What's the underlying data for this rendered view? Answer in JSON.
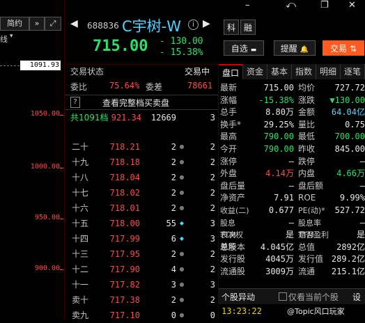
{
  "top_controls": {
    "minimize": "–",
    "back": "⤺",
    "restore": "❐",
    "close": "✕"
  },
  "left_strip": {
    "tab_label": "简约",
    "line_label": "线",
    "ticks": [
      "1091.93",
      "1050.00",
      "1000.00",
      "950.00",
      "900.00"
    ]
  },
  "header": {
    "code": "688836",
    "name": "C宇树-W",
    "price": "715.00",
    "change": "- 130.00",
    "change_pct": "- 15.38%",
    "btn_ke": "科",
    "btn_rong": "融",
    "btn_watchlist": "自选",
    "btn_alert": "提醒",
    "btn_trade": "交易"
  },
  "book": {
    "status_label": "交易状态",
    "status_value": "交易中",
    "weibi_label": "委比",
    "weibi_value": "75.64%",
    "weicha_label": "委差",
    "weicha_value": "78661",
    "help_label": "?",
    "full_book_label": "查看完整档买卖盘",
    "total_label": "共1091档",
    "total_price": "921.34",
    "total_vol": "12669",
    "total_cnt": "3",
    "rows": [
      {
        "label": "二十",
        "price": "718.21",
        "vol": "2",
        "dot": "●",
        "cnt": "2"
      },
      {
        "label": "十九",
        "price": "718.18",
        "vol": "2",
        "dot": "●",
        "cnt": "2"
      },
      {
        "label": "十八",
        "price": "718.04",
        "vol": "2",
        "dot": "●",
        "cnt": "2"
      },
      {
        "label": "十七",
        "price": "718.02",
        "vol": "2",
        "dot": "●",
        "cnt": "2"
      },
      {
        "label": "十六",
        "price": "718.01",
        "vol": "2",
        "dot": "●",
        "cnt": "2"
      },
      {
        "label": "十五",
        "price": "718.00",
        "vol": "55",
        "dot": "◆",
        "cnt": "3"
      },
      {
        "label": "十四",
        "price": "717.99",
        "vol": "6",
        "dot": "◆",
        "cnt": "3"
      },
      {
        "label": "十三",
        "price": "717.95",
        "vol": "2",
        "dot": "●",
        "cnt": "2"
      },
      {
        "label": "十二",
        "price": "717.90",
        "vol": "4",
        "dot": "●",
        "cnt": "2"
      },
      {
        "label": "十一",
        "price": "717.82",
        "vol": "3",
        "dot": "●",
        "cnt": "3"
      },
      {
        "label": "卖十",
        "price": "717.38",
        "vol": "2",
        "dot": "●",
        "cnt": "2"
      },
      {
        "label": "卖九",
        "price": "717.10",
        "vol": "0",
        "dot": "●",
        "cnt": "0"
      }
    ]
  },
  "quote": {
    "tabs": [
      "盘口",
      "资金",
      "基本",
      "指数",
      "明细",
      "逐笔"
    ],
    "rows": [
      {
        "k": "最新",
        "v": "715.00",
        "vc": "white",
        "k2": "均价",
        "v2": "727.72",
        "v2c": "white"
      },
      {
        "k": "涨幅",
        "v": "-15.38%",
        "vc": "green",
        "k2": "涨跌",
        "v2": "▼130.00",
        "v2c": "green"
      },
      {
        "k": "总手",
        "v": "8.80万",
        "vc": "white",
        "k2": "金额",
        "v2": "64.04亿",
        "v2c": "cyan"
      },
      {
        "k": "换手*",
        "v": "29.25%",
        "vc": "white",
        "k2": "量比",
        "v2": "0.75",
        "v2c": "white"
      },
      {
        "k": "最高",
        "v": "790.00",
        "vc": "green",
        "k2": "最低",
        "v2": "700.00",
        "v2c": "green"
      },
      {
        "k": "今开",
        "v": "790.00",
        "vc": "green",
        "k2": "昨收",
        "v2": "845.00",
        "v2c": "white"
      },
      {
        "k": "涨停",
        "v": "—",
        "vc": "white",
        "k2": "跌停",
        "v2": "—",
        "v2c": "white"
      },
      {
        "k": "外盘",
        "v": "4.14万",
        "vc": "red",
        "k2": "内盘",
        "v2": "4.66万",
        "v2c": "green"
      },
      {
        "k": "盘后量",
        "v": "—",
        "vc": "white",
        "k2": "盘后额",
        "v2": "—",
        "v2c": "white"
      },
      {
        "k": "净资产",
        "v": "7.91",
        "vc": "white",
        "k2": "ROE",
        "v2": "9.99%",
        "v2c": "white"
      },
      {
        "k": "收益(二)",
        "v": "0.677",
        "vc": "white",
        "k2": "PE(动)*",
        "v2": "527.72",
        "v2c": "white"
      },
      {
        "k": "股息TTM",
        "v": "—",
        "vc": "white",
        "k2": "股息率TTM",
        "v2": "—",
        "v2c": "white"
      },
      {
        "k": "表决权差异",
        "v": "是",
        "vc": "white",
        "k2": "是否盈利",
        "v2": "是",
        "v2c": "white"
      },
      {
        "k": "总股本",
        "v": "4.045亿",
        "vc": "white",
        "k2": "总值",
        "v2": "2892亿",
        "v2c": "white"
      },
      {
        "k": "发行股",
        "v": "4045万",
        "vc": "white",
        "k2": "发行值",
        "v2": "289.2亿",
        "v2c": "white"
      },
      {
        "k": "流通股",
        "v": "3009万",
        "vc": "white",
        "k2": "流通",
        "v2": "215.1亿",
        "v2c": "white"
      }
    ],
    "alert_title": "个股异动",
    "alert_checkbox": "仅看当前个股",
    "alert_settings": "设",
    "alert_time": "13:23:22",
    "alert_text": "@Topic风口玩家"
  }
}
